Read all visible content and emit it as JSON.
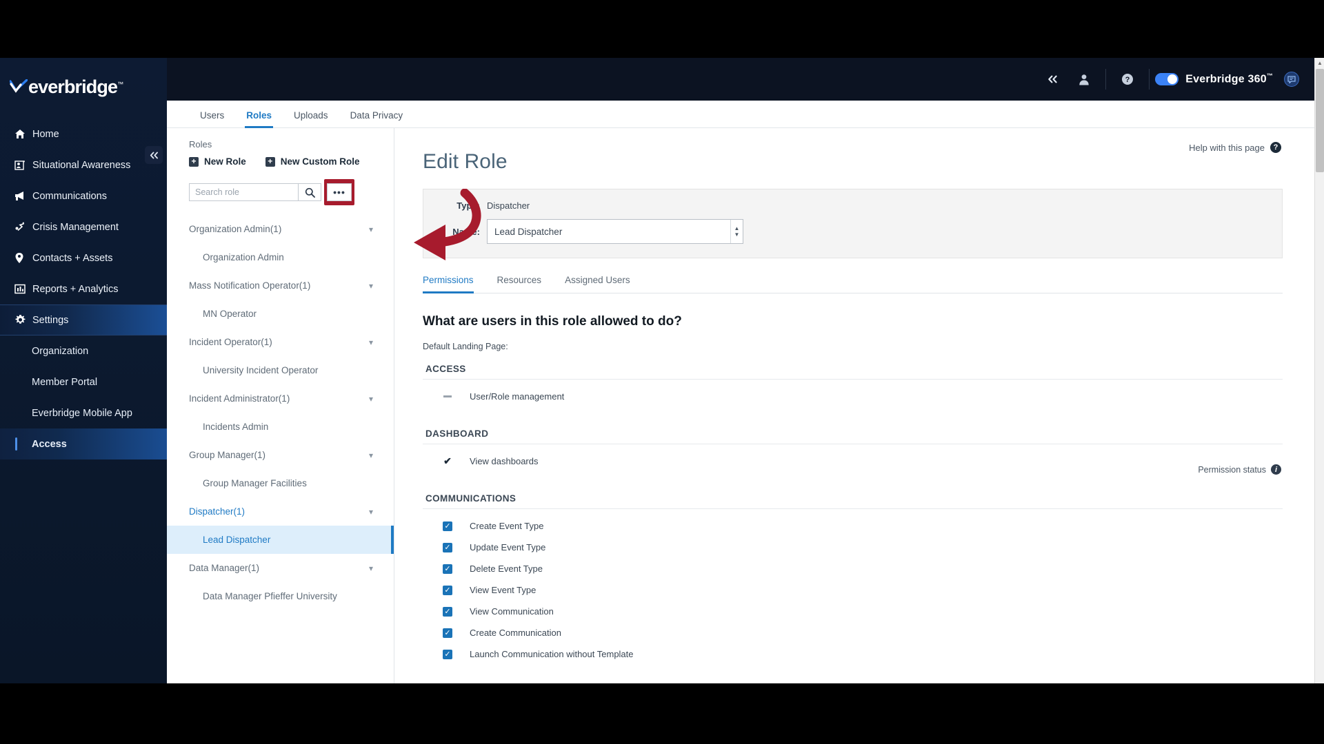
{
  "brand": {
    "name": "everbridge",
    "tm": "™"
  },
  "topbar": {
    "collapse_icon": "chevron-double-left-icon",
    "account_icon": "user-icon",
    "help_icon": "help-circle-icon",
    "toggle_on": true,
    "product_label": "Everbridge 360",
    "product_tm": "™",
    "chat_icon": "feedback-chat-icon"
  },
  "sidebar": {
    "collapse_label": "«",
    "items": [
      {
        "label": "Home",
        "icon": "home-icon",
        "active": false
      },
      {
        "label": "Situational Awareness",
        "icon": "situational-awareness-icon",
        "active": false
      },
      {
        "label": "Communications",
        "icon": "megaphone-icon",
        "active": false
      },
      {
        "label": "Crisis Management",
        "icon": "crisis-management-icon",
        "active": false
      },
      {
        "label": "Contacts + Assets",
        "icon": "location-pin-icon",
        "active": false
      },
      {
        "label": "Reports + Analytics",
        "icon": "bar-chart-icon",
        "active": false
      },
      {
        "label": "Settings",
        "icon": "gear-icon",
        "active": true
      }
    ],
    "sub_items": [
      {
        "label": "Organization",
        "active": false
      },
      {
        "label": "Member Portal",
        "active": false
      },
      {
        "label": "Everbridge Mobile App",
        "active": false
      },
      {
        "label": "Access",
        "active": true
      }
    ]
  },
  "page_tabs": [
    {
      "label": "Users",
      "active": false
    },
    {
      "label": "Roles",
      "active": true
    },
    {
      "label": "Uploads",
      "active": false
    },
    {
      "label": "Data Privacy",
      "active": false
    }
  ],
  "roles_panel": {
    "title": "Roles",
    "new_role_label": "New Role",
    "new_custom_role_label": "New Custom Role",
    "search_placeholder": "Search role",
    "search_value": "",
    "search_icon": "magnifier-icon",
    "more_label": "•••",
    "more_highlight_color": "#a71b2d",
    "tree": [
      {
        "group": "Organization Admin(1)",
        "open": false,
        "children": [
          {
            "label": "Organization Admin",
            "selected": false
          }
        ]
      },
      {
        "group": "Mass Notification Operator(1)",
        "open": false,
        "children": [
          {
            "label": "MN Operator",
            "selected": false
          }
        ]
      },
      {
        "group": "Incident Operator(1)",
        "open": false,
        "children": [
          {
            "label": "University Incident Operator",
            "selected": false
          }
        ]
      },
      {
        "group": "Incident Administrator(1)",
        "open": false,
        "children": [
          {
            "label": "Incidents Admin",
            "selected": false
          }
        ]
      },
      {
        "group": "Group Manager(1)",
        "open": false,
        "children": [
          {
            "label": "Group Manager Facilities",
            "selected": false
          }
        ]
      },
      {
        "group": "Dispatcher(1)",
        "open": true,
        "children": [
          {
            "label": "Lead Dispatcher",
            "selected": true
          }
        ]
      },
      {
        "group": "Data Manager(1)",
        "open": false,
        "children": [
          {
            "label": "Data Manager Pfieffer University",
            "selected": false
          }
        ]
      }
    ]
  },
  "edit_role": {
    "help_link": "Help with this page",
    "help_icon": "help-circle-icon",
    "title": "Edit Role",
    "type_label": "Type:",
    "type_value": "Dispatcher",
    "name_label": "Name:",
    "name_value": "Lead Dispatcher",
    "tabs": [
      {
        "label": "Permissions",
        "active": true
      },
      {
        "label": "Resources",
        "active": false
      },
      {
        "label": "Assigned Users",
        "active": false
      }
    ],
    "question": "What are users in this role allowed to do?",
    "permission_status_label": "Permission status",
    "permission_status_icon": "info-icon",
    "landing_label": "Default Landing Page:",
    "sections": [
      {
        "name": "ACCESS",
        "items": [
          {
            "label": "User/Role management",
            "state": "partial"
          }
        ]
      },
      {
        "name": "DASHBOARD",
        "items": [
          {
            "label": "View dashboards",
            "state": "check"
          }
        ]
      },
      {
        "name": "COMMUNICATIONS",
        "items": [
          {
            "label": "Create Event Type",
            "state": "checked"
          },
          {
            "label": "Update Event Type",
            "state": "checked"
          },
          {
            "label": "Delete Event Type",
            "state": "checked"
          },
          {
            "label": "View Event Type",
            "state": "checked"
          },
          {
            "label": "View Communication",
            "state": "checked"
          },
          {
            "label": "Create Communication",
            "state": "checked"
          },
          {
            "label": "Launch Communication without Template",
            "state": "checked"
          }
        ]
      }
    ]
  },
  "annotation": {
    "arrow_color": "#a71b2d",
    "points_to": "edit-role-title"
  },
  "colors": {
    "accent": "#1f7ac4",
    "sidebar_bg": "#0c1a30",
    "highlight_red": "#a71b2d",
    "checkbox_blue": "#1a73b7"
  }
}
